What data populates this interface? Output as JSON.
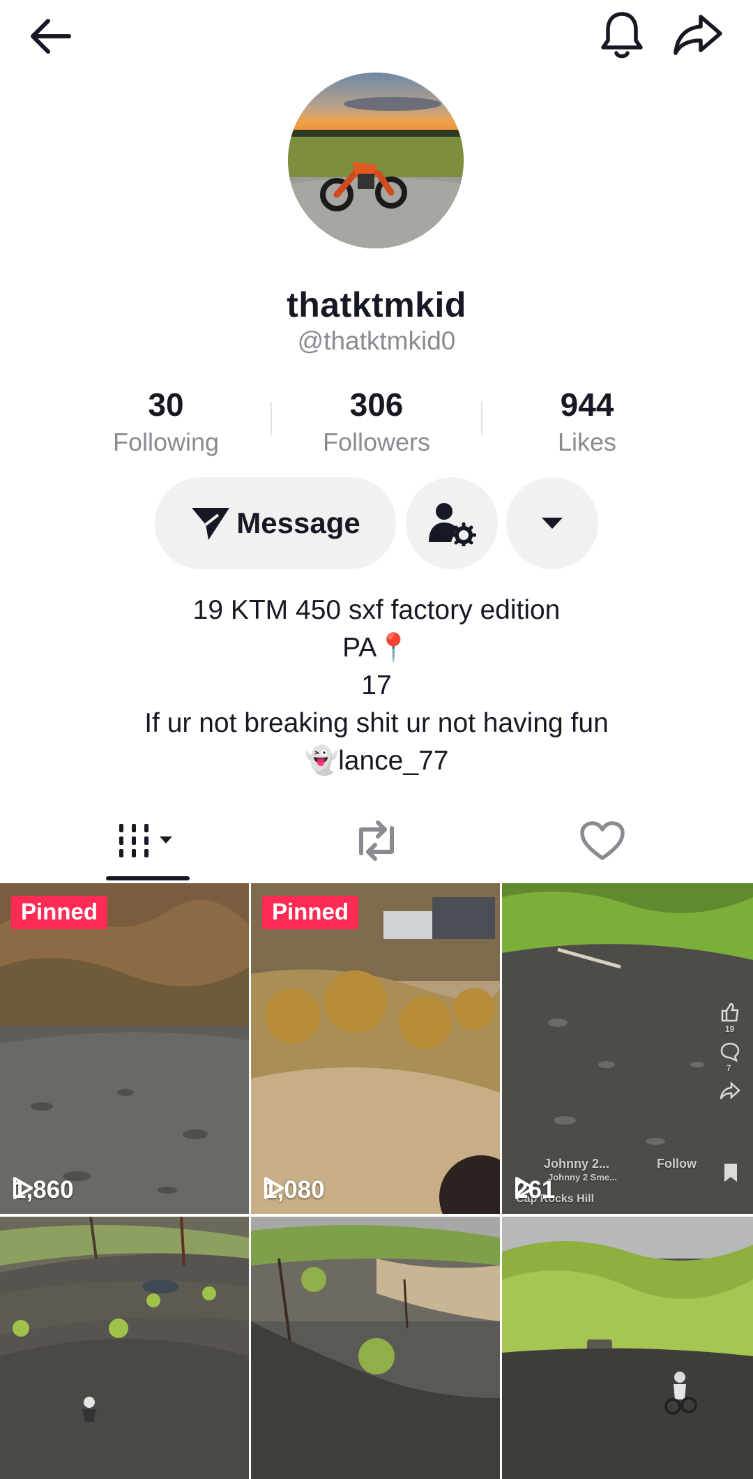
{
  "header": {
    "back_icon": "arrow-left-icon",
    "notification_icon": "bell-icon",
    "share_icon": "share-arrow-icon"
  },
  "profile": {
    "display_name": "thatktmkid",
    "handle": "@thatktmkid0"
  },
  "stats": [
    {
      "value": "30",
      "label": "Following"
    },
    {
      "value": "306",
      "label": "Followers"
    },
    {
      "value": "944",
      "label": "Likes"
    }
  ],
  "actions": {
    "message_label": "Message",
    "message_icon": "send-icon",
    "manage_icon": "user-settings-icon",
    "more_icon": "caret-down-icon"
  },
  "bio": {
    "line1": "19 KTM 450 sxf factory edition",
    "line2": "PA📍",
    "line3": "17",
    "line4": "If ur not breaking shit ur not having fun",
    "line5": "👻lance_77"
  },
  "tabs": [
    {
      "icon": "videos-grid-icon"
    },
    {
      "icon": "repost-icon"
    },
    {
      "icon": "heart-icon"
    }
  ],
  "videos": [
    {
      "pinned_label": "Pinned",
      "views": "1,860"
    },
    {
      "pinned_label": "Pinned",
      "views": "1,080"
    },
    {
      "pinned_label": "",
      "views": "261",
      "overlay_user": "Johnny 2...",
      "overlay_follow": "Follow",
      "overlay_sub": "Johnny 2 Sme...",
      "overlay_place": "Cap Rocks Hill",
      "overlay_likes": "19",
      "overlay_comments": "7"
    },
    {
      "pinned_label": "",
      "views": ""
    },
    {
      "pinned_label": "",
      "views": ""
    },
    {
      "pinned_label": "",
      "views": ""
    }
  ],
  "colors": {
    "accent": "#fe2c55",
    "text_primary": "#161823",
    "text_secondary": "#8a8b91",
    "button_bg": "#f1f1f2"
  }
}
